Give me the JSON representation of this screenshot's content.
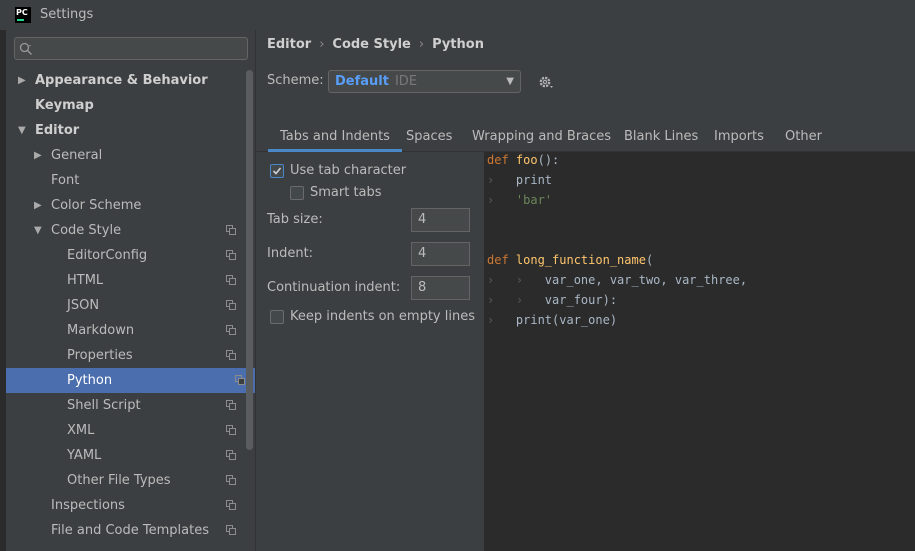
{
  "window": {
    "title": "Settings",
    "app_icon_text": "PC"
  },
  "sidebar": {
    "search_placeholder": "",
    "items": [
      {
        "label": "Appearance & Behavior",
        "arrow": "▶",
        "bold": true
      },
      {
        "label": "Keymap",
        "arrow": "",
        "bold": true
      },
      {
        "label": "Editor",
        "arrow": "▼",
        "bold": true
      },
      {
        "label": "General",
        "arrow": "▶"
      },
      {
        "label": "Font",
        "arrow": ""
      },
      {
        "label": "Color Scheme",
        "arrow": "▶"
      },
      {
        "label": "Code Style",
        "arrow": "▼",
        "copy": true
      },
      {
        "label": "EditorConfig",
        "copy": true
      },
      {
        "label": "HTML",
        "copy": true
      },
      {
        "label": "JSON",
        "copy": true
      },
      {
        "label": "Markdown",
        "copy": true
      },
      {
        "label": "Properties",
        "copy": true
      },
      {
        "label": "Python",
        "copy": true,
        "selected": true
      },
      {
        "label": "Shell Script",
        "copy": true
      },
      {
        "label": "XML",
        "copy": true
      },
      {
        "label": "YAML",
        "copy": true
      },
      {
        "label": "Other File Types",
        "copy": true
      },
      {
        "label": "Inspections",
        "copy": true
      },
      {
        "label": "File and Code Templates",
        "copy": true
      }
    ]
  },
  "breadcrumb": {
    "items": [
      "Editor",
      "Code Style",
      "Python"
    ],
    "separator": "›"
  },
  "scheme": {
    "label": "Scheme:",
    "value": "Default",
    "sub": "IDE"
  },
  "tabs": [
    "Tabs and Indents",
    "Spaces",
    "Wrapping and Braces",
    "Blank Lines",
    "Imports",
    "Other"
  ],
  "options": {
    "use_tab": {
      "label": "Use tab character",
      "checked": true
    },
    "smart_tabs": {
      "label": "Smart tabs",
      "checked": false
    },
    "tab_size": {
      "label": "Tab size:",
      "value": "4"
    },
    "indent": {
      "label": "Indent:",
      "value": "4"
    },
    "continuation": {
      "label": "Continuation indent:",
      "value": "8"
    },
    "keep_indents": {
      "label": "Keep indents on empty lines",
      "checked": false
    }
  },
  "preview": {
    "lines": [
      {
        "indent": "",
        "kw": "def ",
        "fn": "foo",
        "rest": "():"
      },
      {
        "indent": "›   ",
        "text": "print"
      },
      {
        "indent": "›   ",
        "str": "'bar'"
      },
      {
        "indent": "",
        "text": ""
      },
      {
        "indent": "",
        "text": ""
      },
      {
        "indent": "",
        "kw": "def ",
        "fn": "long_function_name",
        "rest": "("
      },
      {
        "indent": "›   ›   ",
        "text": "var_one, var_two, var_three,"
      },
      {
        "indent": "›   ›   ",
        "text": "var_four):"
      },
      {
        "indent": "›   ",
        "text": "print(var_one)"
      }
    ]
  },
  "colors": {
    "accent": "#4b6eaf",
    "link": "#589df6",
    "keyword": "#cc7832",
    "function": "#ffc66d",
    "string": "#6a8759",
    "text": "#a9b7c6"
  }
}
